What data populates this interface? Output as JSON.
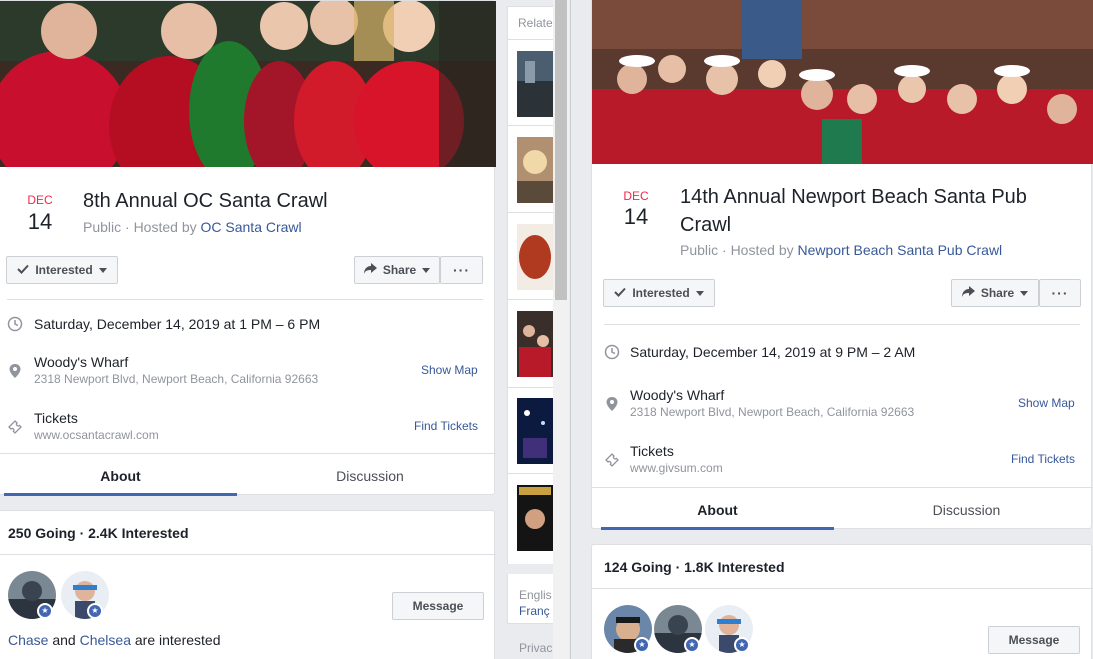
{
  "left": {
    "event": {
      "month": "DEC",
      "day": "14",
      "title": "8th Annual OC Santa Crawl",
      "visibility": "Public · Hosted by ",
      "host": "OC Santa Crawl",
      "interested_label": "Interested",
      "share_label": "Share",
      "more_label": "···",
      "datetime": "Saturday, December 14, 2019 at 1 PM – 6 PM",
      "venue": "Woody's Wharf",
      "address": "2318 Newport Blvd, Newport Beach, California 92663",
      "show_map": "Show Map",
      "tickets_label": "Tickets",
      "tickets_url": "www.ocsantacrawl.com",
      "find_tickets": "Find Tickets",
      "tab_about": "About",
      "tab_discussion": "Discussion",
      "going_summary": "250 Going · 2.4K Interested",
      "message_label": "Message",
      "friend1": "Chase",
      "and_word": " and ",
      "friend2": "Chelsea",
      "interested_suffix": " are interested"
    },
    "sidebar": {
      "related_label": "Relate",
      "lang1": "Englis",
      "lang2": "Franç",
      "privacy": "Privac"
    }
  },
  "right": {
    "event": {
      "month": "DEC",
      "day": "14",
      "title_line1": "14th Annual Newport Beach Santa Pub",
      "title_line2": "Crawl",
      "visibility": "Public · Hosted by ",
      "host": "Newport Beach Santa Pub Crawl",
      "interested_label": "Interested",
      "share_label": "Share",
      "more_label": "···",
      "datetime": "Saturday, December 14, 2019 at 9 PM – 2 AM",
      "venue": "Woody's Wharf",
      "address": "2318 Newport Blvd, Newport Beach, California 92663",
      "show_map": "Show Map",
      "tickets_label": "Tickets",
      "tickets_url": "www.givsum.com",
      "find_tickets": "Find Tickets",
      "tab_about": "About",
      "tab_discussion": "Discussion",
      "going_summary": "124 Going · 1.8K Interested",
      "message_label": "Message"
    }
  },
  "icons": {
    "clock": "clock-icon",
    "pin": "map-pin-icon",
    "ticket": "ticket-icon",
    "check": "check-icon",
    "share": "share-arrow-icon"
  },
  "colors": {
    "accent": "#4267b2",
    "link": "#385898",
    "date_red": "#f02849"
  }
}
